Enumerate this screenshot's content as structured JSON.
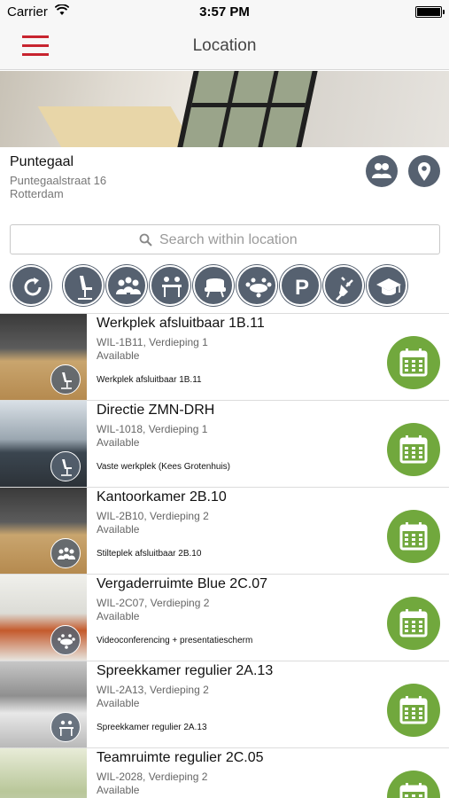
{
  "status_bar": {
    "carrier": "Carrier",
    "time": "3:57 PM"
  },
  "nav": {
    "title": "Location"
  },
  "location": {
    "name": "Puntegaal",
    "street": "Puntegaalstraat 16",
    "city": "Rotterdam"
  },
  "search": {
    "placeholder": "Search within location"
  },
  "filters": [
    "reset-icon",
    "office-chair-icon",
    "meeting-icon",
    "desk-icon",
    "lounge-chair-icon",
    "conference-icon",
    "parking-icon",
    "power-plug-icon",
    "graduation-cap-icon"
  ],
  "items": [
    {
      "title": "Werkplek afsluitbaar 1B.11",
      "code": "WIL-1B11, Verdieping 1",
      "status": "Available",
      "desc": "Werkplek afsluitbaar 1B.11",
      "badge": "office-chair-icon"
    },
    {
      "title": "Directie ZMN-DRH",
      "code": "WIL-1018, Verdieping 1",
      "status": "Available",
      "desc": "Vaste werkplek (Kees Grotenhuis)",
      "badge": "office-chair-icon"
    },
    {
      "title": "Kantoorkamer 2B.10",
      "code": "WIL-2B10, Verdieping 2",
      "status": "Available",
      "desc": "Stilteplek afsluitbaar 2B.10",
      "badge": "meeting-icon"
    },
    {
      "title": "Vergaderruimte Blue 2C.07",
      "code": "WIL-2C07, Verdieping 2",
      "status": "Available",
      "desc": "Videoconferencing + presentatiescherm",
      "badge": "conference-icon"
    },
    {
      "title": "Spreekkamer regulier 2A.13",
      "code": "WIL-2A13, Verdieping 2",
      "status": "Available",
      "desc": "Spreekkamer regulier 2A.13",
      "badge": "desk-icon"
    },
    {
      "title": "Teamruimte regulier 2C.05",
      "code": "WIL-2028, Verdieping 2",
      "status": "Available",
      "desc": "",
      "badge": ""
    }
  ],
  "colors": {
    "accent_red": "#c8242f",
    "icon_slate": "#566170",
    "book_green": "#71a83d"
  }
}
